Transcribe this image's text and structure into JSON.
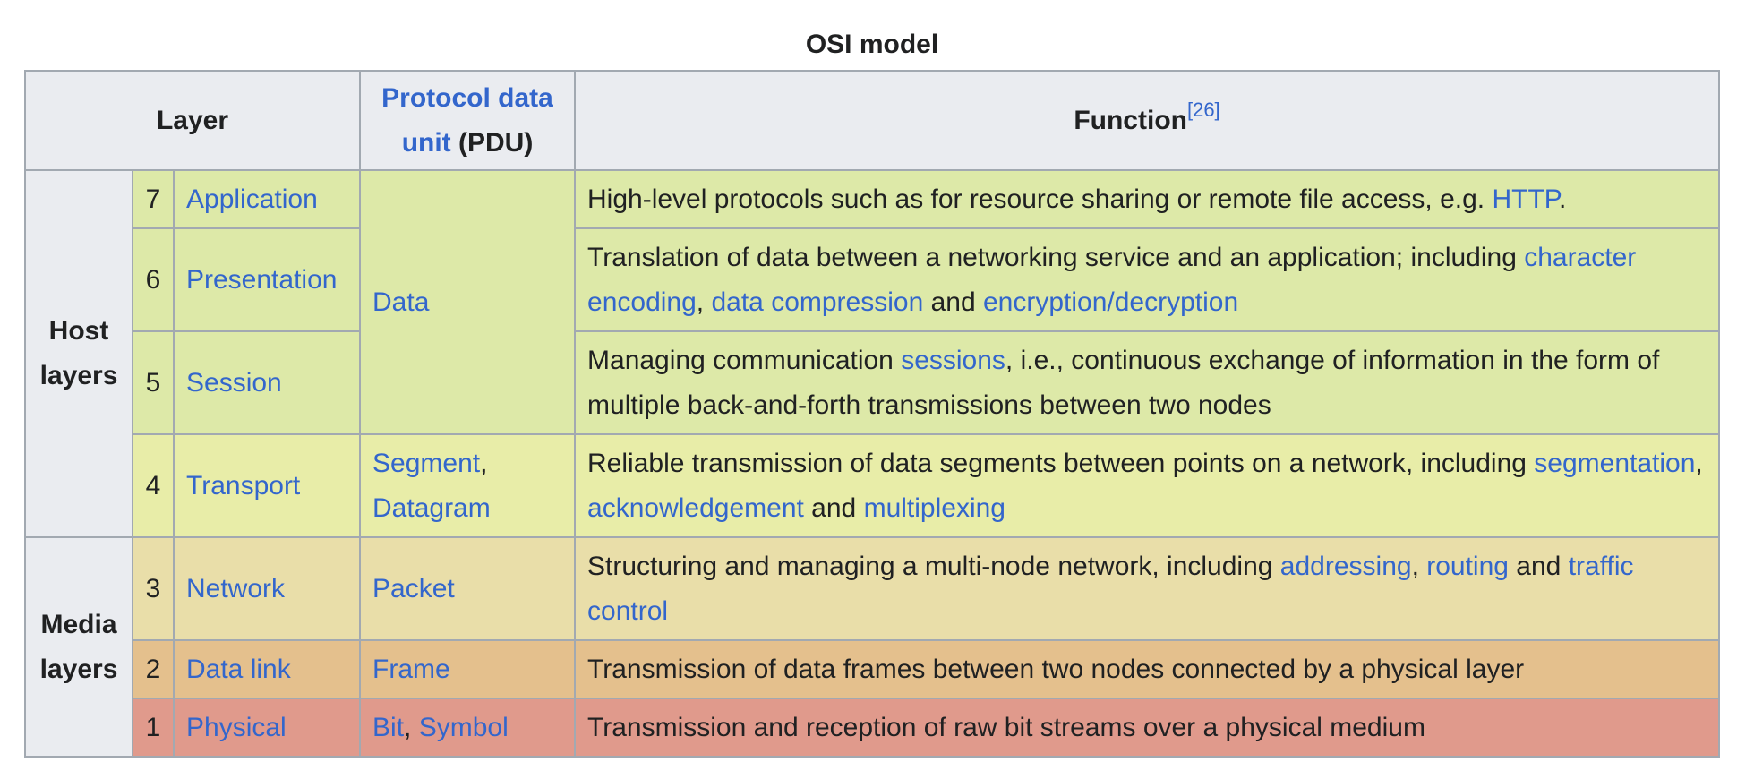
{
  "caption": "OSI model",
  "headers": {
    "layer": "Layer",
    "pdu_link": "Protocol data unit",
    "pdu_suffix": " (PDU)",
    "function": "Function",
    "function_ref": "[26]"
  },
  "groups": {
    "host": "Host layers",
    "media": "Media layers"
  },
  "layers": [
    {
      "num": "7",
      "name": "Application",
      "pdu": "Data",
      "function": [
        {
          "t": "High-level protocols such as for resource sharing or remote file access, e.g. "
        },
        {
          "t": "HTTP",
          "link": true
        },
        {
          "t": "."
        }
      ]
    },
    {
      "num": "6",
      "name": "Presentation",
      "function": [
        {
          "t": "Translation of data between a networking service and an application; including "
        },
        {
          "t": "character encoding",
          "link": true
        },
        {
          "t": ", "
        },
        {
          "t": "data compression",
          "link": true
        },
        {
          "t": " and "
        },
        {
          "t": "encryption/decryption",
          "link": true
        }
      ]
    },
    {
      "num": "5",
      "name": "Session",
      "function": [
        {
          "t": "Managing communication "
        },
        {
          "t": "sessions",
          "link": true
        },
        {
          "t": ", i.e., continuous exchange of information in the form of multiple back-and-forth transmissions between two nodes"
        }
      ]
    },
    {
      "num": "4",
      "name": "Transport",
      "pdu_parts": [
        {
          "t": "Segment",
          "link": true
        },
        {
          "t": ", "
        },
        {
          "t": "Datagram",
          "link": true
        }
      ],
      "function": [
        {
          "t": "Reliable transmission of data segments between points on a network, including "
        },
        {
          "t": "segmentation",
          "link": true
        },
        {
          "t": ", "
        },
        {
          "t": "acknowledgement",
          "link": true
        },
        {
          "t": " and "
        },
        {
          "t": "multiplexing",
          "link": true
        }
      ]
    },
    {
      "num": "3",
      "name": "Network",
      "pdu_parts": [
        {
          "t": "Packet",
          "link": true
        }
      ],
      "function": [
        {
          "t": "Structuring and managing a multi-node network, including "
        },
        {
          "t": "addressing",
          "link": true
        },
        {
          "t": ", "
        },
        {
          "t": "routing",
          "link": true
        },
        {
          "t": " and "
        },
        {
          "t": "traffic control",
          "link": true
        }
      ]
    },
    {
      "num": "2",
      "name": "Data link",
      "pdu_parts": [
        {
          "t": "Frame",
          "link": true
        }
      ],
      "function": [
        {
          "t": "Transmission of data frames between two nodes connected by a physical layer"
        }
      ]
    },
    {
      "num": "1",
      "name": "Physical",
      "pdu_parts": [
        {
          "t": "Bit",
          "link": true
        },
        {
          "t": ", "
        },
        {
          "t": "Symbol",
          "link": true
        }
      ],
      "function": [
        {
          "t": "Transmission and reception of raw bit streams over a physical medium"
        }
      ]
    }
  ]
}
